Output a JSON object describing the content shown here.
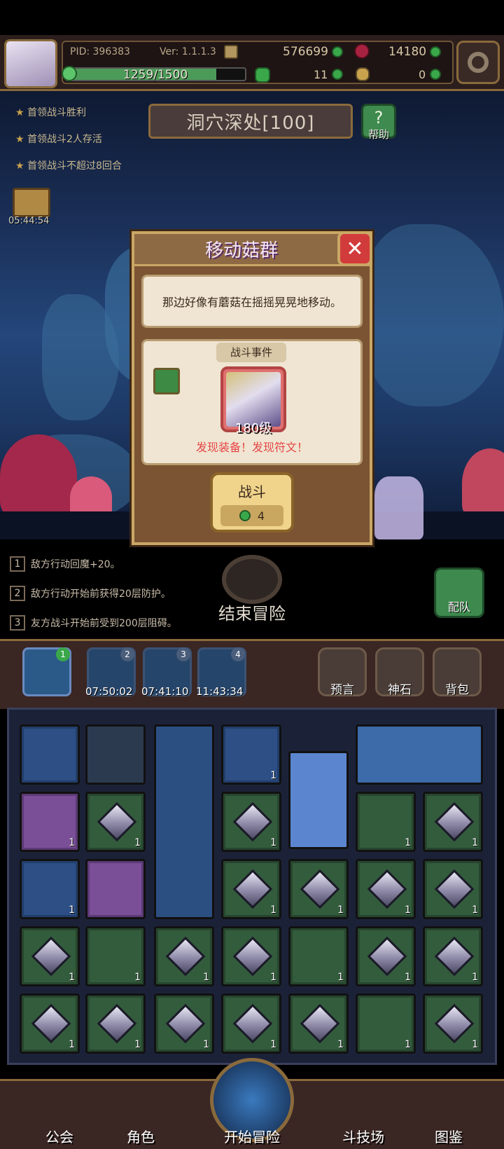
{
  "player": {
    "pid": "PID: 396383",
    "version": "Ver: 1.1.1.3",
    "coins": "576699",
    "gems": "14180",
    "stamina": "1259/1500",
    "clover": "11",
    "keys": "0"
  },
  "stage": {
    "title": "洞穴深处[100]",
    "help_label": "帮助"
  },
  "objectives": [
    "首领战斗胜利",
    "首领战斗2人存活",
    "首领战斗不超过8回合"
  ],
  "chest_timer": "05:44:54",
  "modal": {
    "title": "移动菇群",
    "description": "那边好像有蘑菇在摇摇晃晃地移动。",
    "section_title": "战斗事件",
    "enemy_level": "180级",
    "reward_text": "发现装备！发现符文！",
    "fight_label": "战斗",
    "fight_cost": "4"
  },
  "effects": [
    {
      "num": "1",
      "text": "敌方行动回魔+20。"
    },
    {
      "num": "2",
      "text": "敌方行动开始前获得20层防护。"
    },
    {
      "num": "3",
      "text": "友方战斗开始前受到200层阻碍。"
    }
  ],
  "end_adventure_label": "结束冒险",
  "team_label": "配队",
  "slots": [
    {
      "badge": "1",
      "timer": ""
    },
    {
      "badge": "2",
      "timer": "07:50:02"
    },
    {
      "badge": "3",
      "timer": "07:41:10"
    },
    {
      "badge": "4",
      "timer": "11:43:34"
    }
  ],
  "side_buttons": [
    "预言",
    "神石",
    "背包"
  ],
  "grid_counts": "1",
  "bottom_nav": [
    "公会",
    "角色",
    "开始冒险",
    "斗技场",
    "图鉴"
  ],
  "colors": {
    "accent": "#caa765",
    "danger": "#e64646",
    "green": "#3aa84a"
  }
}
